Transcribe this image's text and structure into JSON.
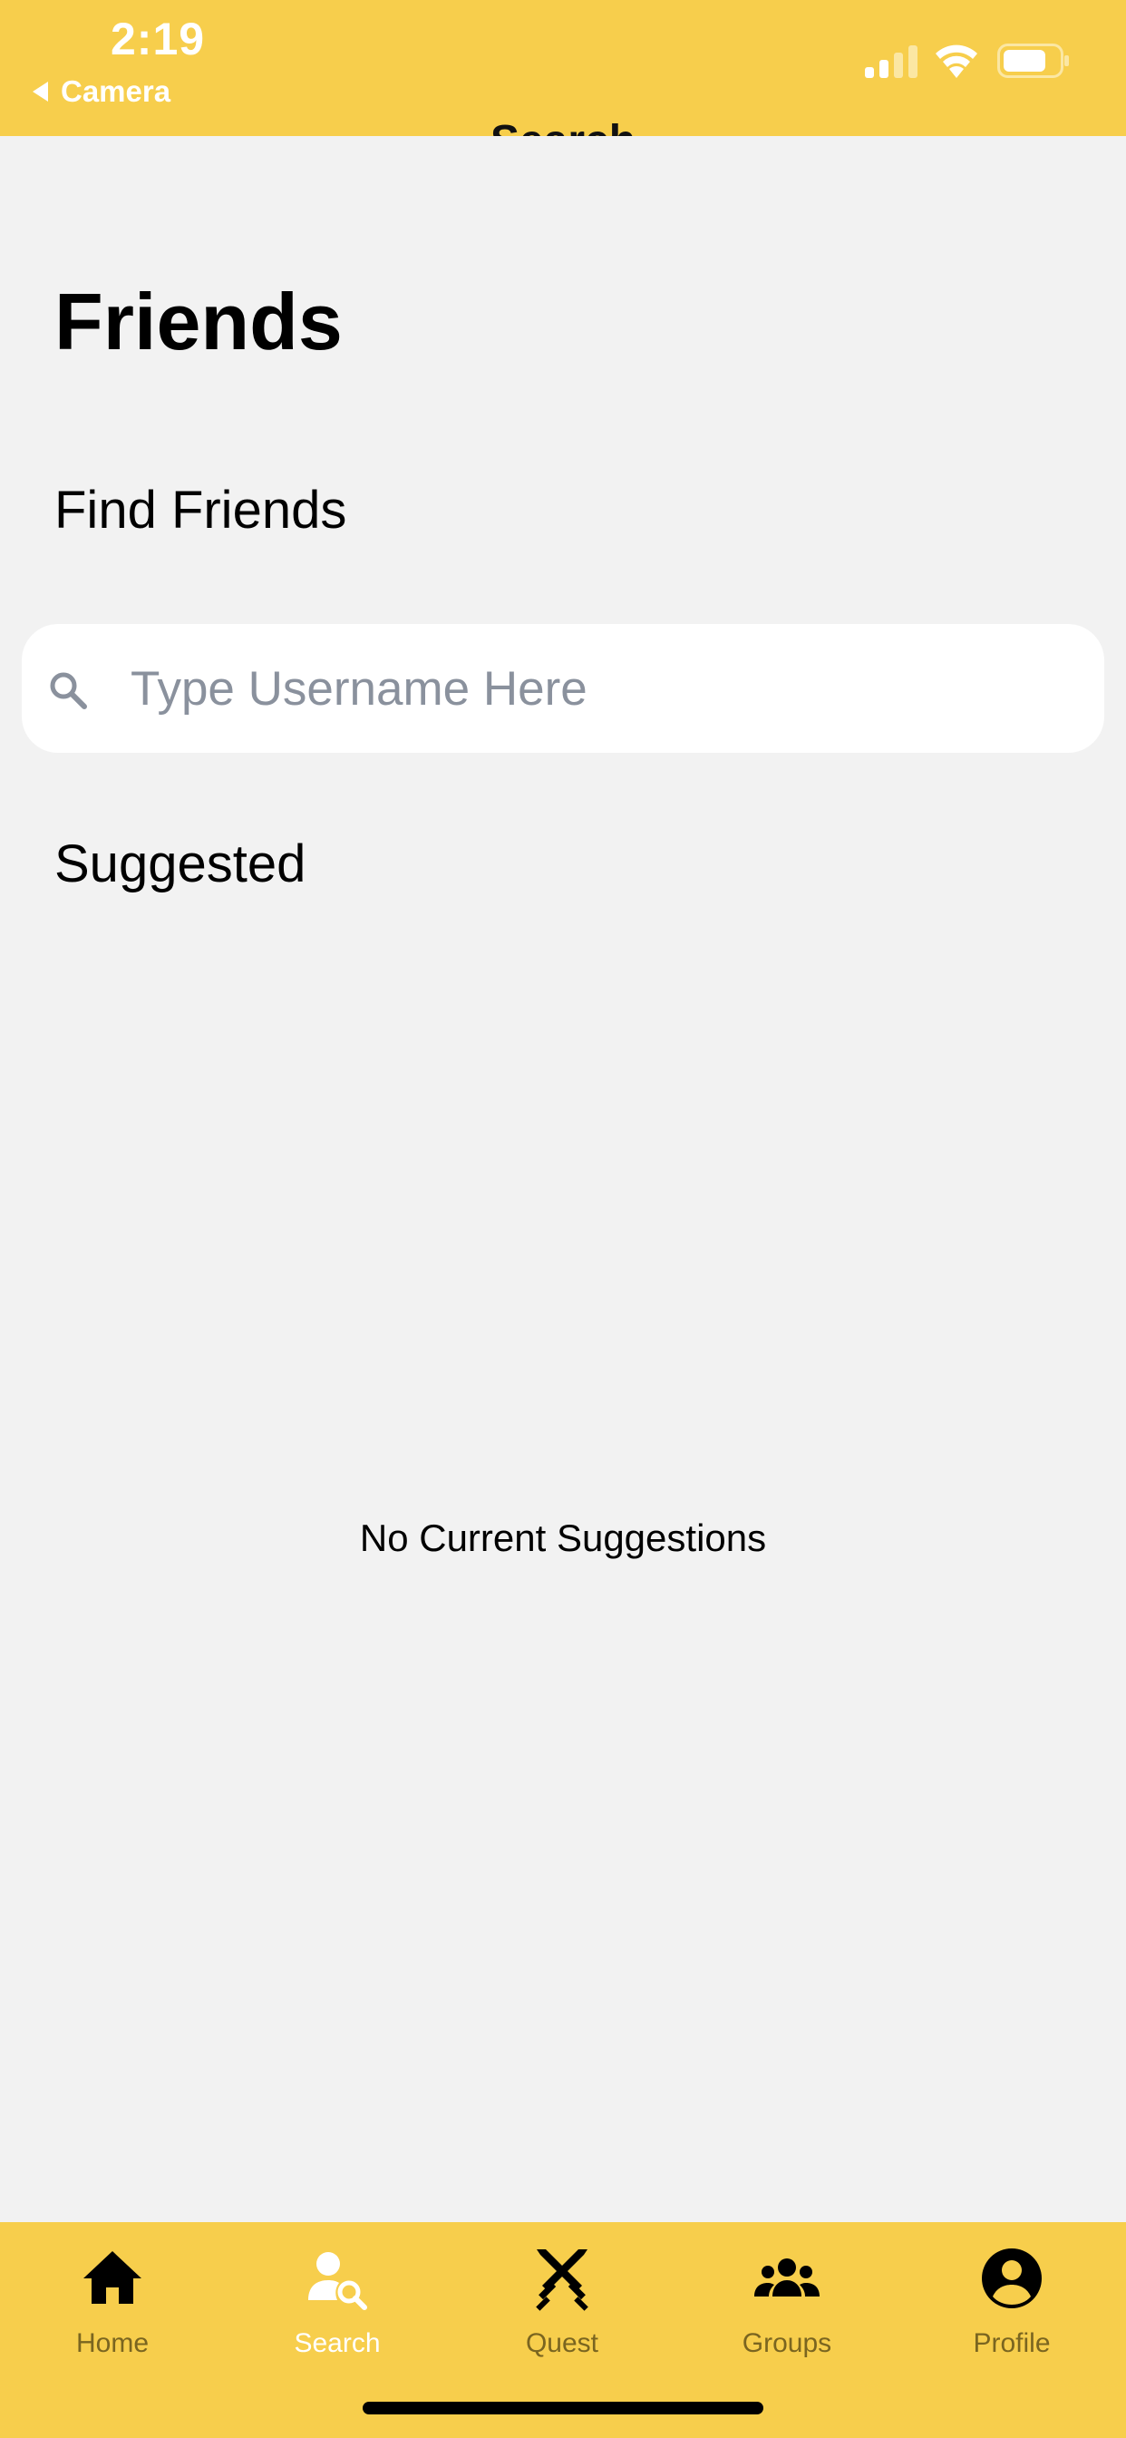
{
  "status_bar": {
    "time": "2:19",
    "back_app": "Camera",
    "partial_title": "Search",
    "background_color": "#f7ce4c"
  },
  "main": {
    "title": "Friends",
    "find_section_label": "Find Friends",
    "search": {
      "placeholder": "Type Username Here",
      "value": "",
      "icon": "search-icon"
    },
    "suggested_section_label": "Suggested",
    "empty_message": "No Current Suggestions"
  },
  "tab_bar": {
    "background_color": "#f7ce4c",
    "active_tab": "Search",
    "tabs": [
      {
        "label": "Home",
        "icon": "home-icon"
      },
      {
        "label": "Search",
        "icon": "person-search-icon"
      },
      {
        "label": "Quest",
        "icon": "crossed-swords-icon"
      },
      {
        "label": "Groups",
        "icon": "groups-icon"
      },
      {
        "label": "Profile",
        "icon": "profile-icon"
      }
    ]
  }
}
